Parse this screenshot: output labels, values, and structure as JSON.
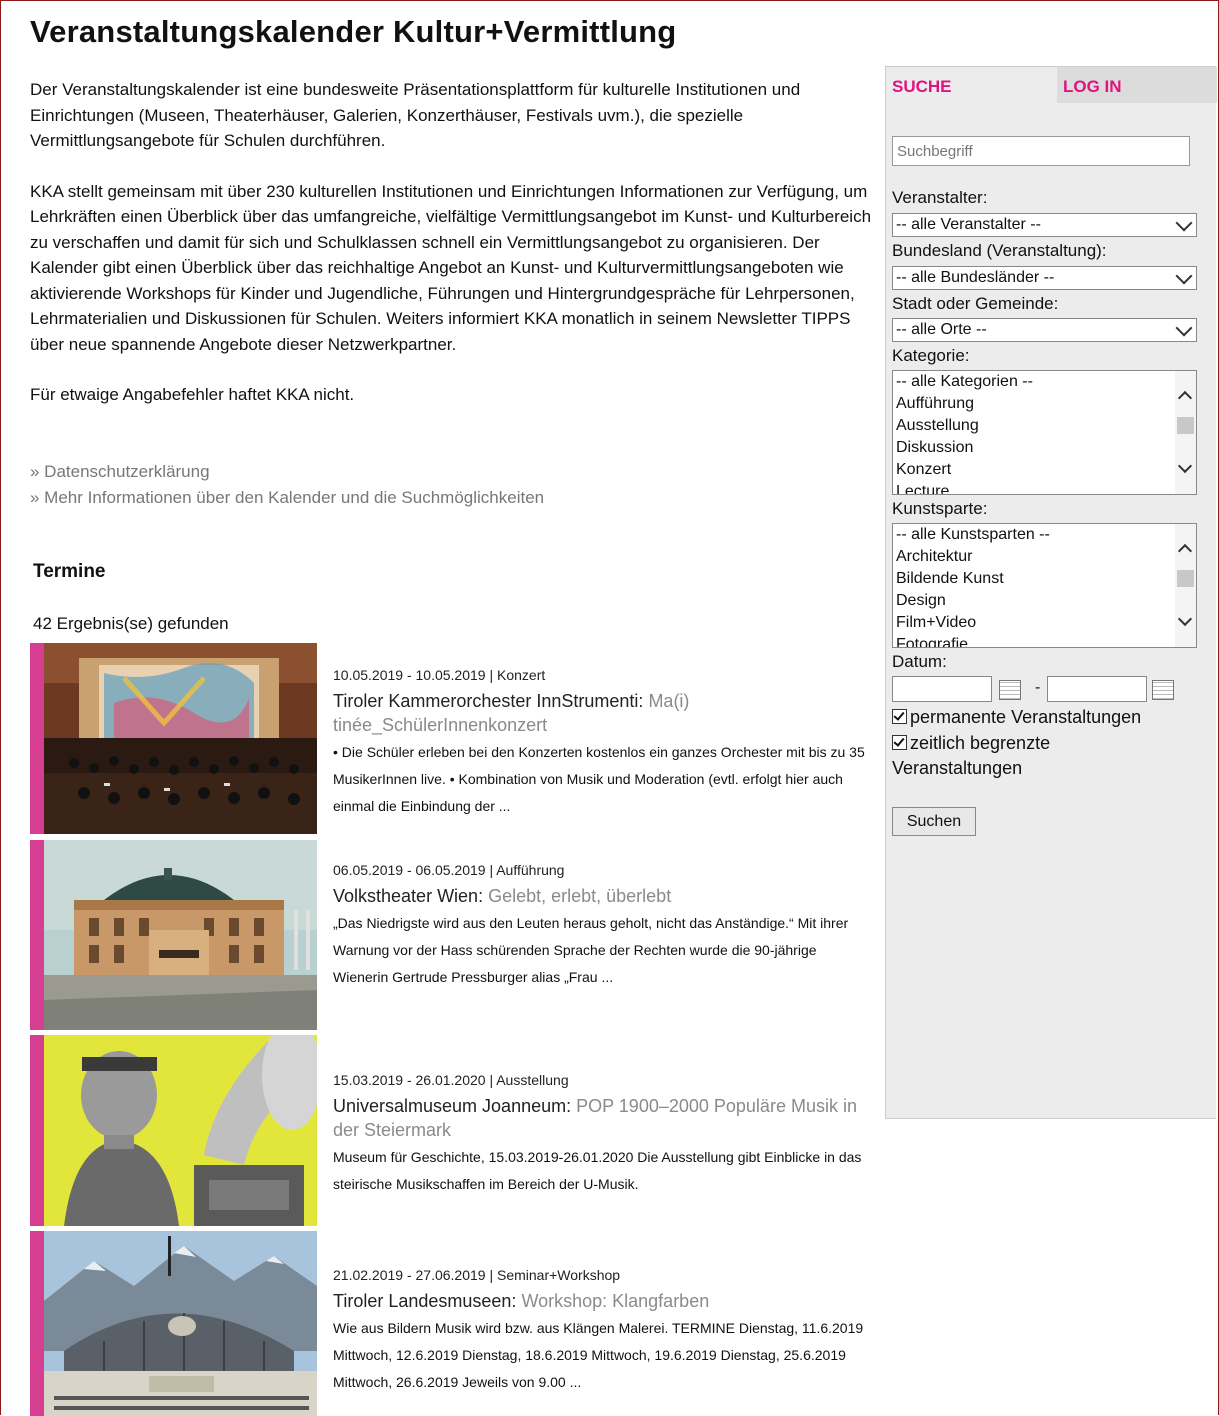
{
  "page": {
    "title": "Veranstaltungskalender Kultur+Vermittlung",
    "intro": [
      "Der Veranstaltungskalender ist eine bundesweite Präsentationsplattform für kulturelle Institutionen und Einrichtungen (Museen, Theaterhäuser, Galerien, Konzerthäuser, Festivals uvm.), die spezielle Vermittlungsangebote für Schulen durchführen.",
      "KKA stellt gemeinsam mit über 230 kulturellen Institutionen und Einrichtungen Informationen zur Verfügung, um Lehrkräften einen Überblick über das umfangreiche, vielfältige Vermittlungsangebot im Kunst- und Kulturbereich zu verschaffen und damit für sich und Schulklassen schnell ein Vermittlungsangebot zu organisieren. Der Kalender gibt einen Überblick über das reichhaltige Angebot an Kunst- und Kulturvermittlungsangeboten wie aktivierende Workshops für Kinder und Jugendliche, Führungen und Hintergrundgespräche für Lehrpersonen, Lehrmaterialien und Diskussionen für Schulen. Weiters informiert KKA monatlich in seinem Newsletter TIPPS über neue spannende Angebote dieser Netzwerkpartner.",
      "Für etwaige Angabefehler haftet KKA nicht."
    ],
    "links": [
      "» Datenschutzerklärung",
      "» Mehr Informationen über den Kalender und die Suchmöglichkeiten"
    ],
    "section_title": "Termine",
    "result_count": "42 Ergebnis(se) gefunden"
  },
  "events": [
    {
      "meta": "10.05.2019 - 10.05.2019 | Konzert",
      "org": "Tiroler Kammerorchester InnStrumenti: ",
      "subtitle": "Ma(i) tinée_SchülerInnenkonzert",
      "desc": "• Die Schüler erleben bei den Konzerten kostenlos ein ganzes Orchester mit bis zu 35 MusikerInnen live. • Kombination von Musik und Moderation (evtl. erfolgt hier auch einmal die Einbindung der ..."
    },
    {
      "meta": "06.05.2019 - 06.05.2019 | Aufführung",
      "org": "Volkstheater Wien: ",
      "subtitle": "Gelebt, erlebt, überlebt",
      "desc": "„Das Niedrigste wird aus den Leuten heraus geholt, nicht das Anständige.“ Mit ihrer Warnung vor der Hass schürenden Sprache der Rechten wurde die 90-jährige Wienerin Gertrude Pressburger alias „Frau ..."
    },
    {
      "meta": "15.03.2019 - 26.01.2020 | Ausstellung",
      "org": "Universalmuseum Joanneum: ",
      "subtitle": "POP 1900–2000 Populäre Musik in der Steiermark",
      "desc": "Museum für Geschichte, 15.03.2019-26.01.2020 Die Ausstellung gibt Einblicke in das steirische Musikschaffen im Bereich der U-Musik."
    },
    {
      "meta": "21.02.2019 - 27.06.2019 | Seminar+Workshop",
      "org": "Tiroler Landesmuseen: ",
      "subtitle": "Workshop: Klangfarben",
      "desc": "Wie aus Bildern Musik wird bzw. aus Klängen Malerei. TERMINE Dienstag, 11.6.2019 Mittwoch, 12.6.2019 Dienstag, 18.6.2019 Mittwoch, 19.6.2019 Dienstag, 25.6.2019 Mittwoch, 26.6.2019 Jeweils von 9.00 ..."
    }
  ],
  "sidebar": {
    "tab_search": "SUCHE",
    "tab_login": "LOG IN",
    "search_placeholder": "Suchbegriff",
    "veranstalter_label": "Veranstalter:",
    "veranstalter_value": "-- alle Veranstalter --",
    "bundesland_label": "Bundesland (Veranstaltung):",
    "bundesland_value": "-- alle Bundesländer --",
    "stadt_label": "Stadt oder Gemeinde:",
    "stadt_value": "-- alle Orte --",
    "kategorie_label": "Kategorie:",
    "kategorie_options": [
      "-- alle Kategorien --",
      "Aufführung",
      "Ausstellung",
      "Diskussion",
      "Konzert",
      "Lecture"
    ],
    "kunstsparte_label": "Kunstsparte:",
    "kunstsparte_options": [
      "-- alle Kunstsparten --",
      "Architektur",
      "Bildende Kunst",
      "Design",
      "Film+Video",
      "Fotografie"
    ],
    "datum_label": "Datum:",
    "date_separator": "-",
    "check_permanent": "permanente Veranstaltungen",
    "check_limited_1": "zeitlich begrenzte",
    "check_limited_2": "Veranstaltungen",
    "submit": "Suchen"
  },
  "colors": {
    "accent": "#e0127d",
    "bar": "#d63e91",
    "frame": "#8b1b1b"
  }
}
